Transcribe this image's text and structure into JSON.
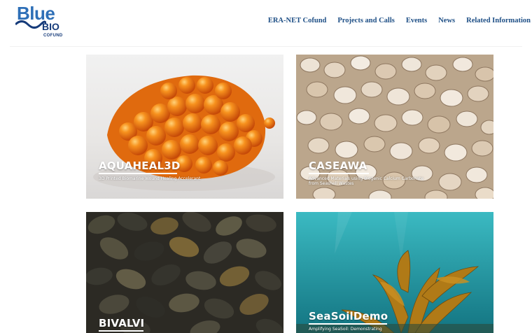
{
  "logo": {
    "line1": "Blue",
    "line2": "BIO",
    "line3": "COFUND"
  },
  "nav": {
    "items": [
      {
        "label": "ERA-NET Cofund"
      },
      {
        "label": "Projects and Calls"
      },
      {
        "label": "Events"
      },
      {
        "label": "News"
      },
      {
        "label": "Related Information"
      }
    ]
  },
  "projects": [
    {
      "title": "AQUAHEAL3D",
      "subtitle": "3D Printed Biomarine Wound Healing Accelerant"
    },
    {
      "title": "CASEAWA",
      "subtitle": "Advanced Materials using Biogenic Calcium Carbonate from Seashell Wastes"
    },
    {
      "title": "BIVALVI",
      "subtitle": ""
    },
    {
      "title": "SeaSoilDemo",
      "subtitle": "Amplifying SeaSoil: Demonstrating"
    }
  ],
  "colors": {
    "nav_text": "#1e4f86",
    "logo_blue": "#2e6fb7",
    "logo_dark": "#163b7a"
  }
}
